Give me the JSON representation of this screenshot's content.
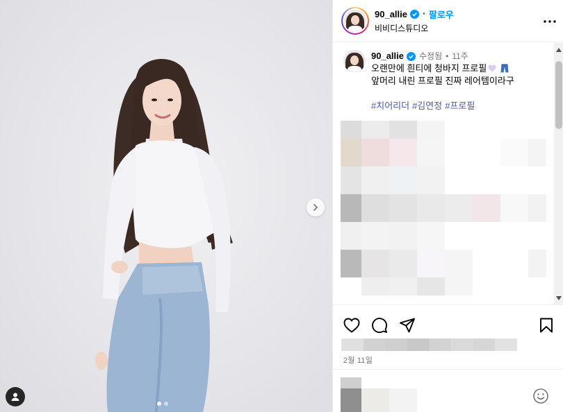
{
  "post": {
    "username": "90_allie",
    "verified": true,
    "follow_label": "팔로우",
    "separator": "•",
    "location": "비비디스튜디오"
  },
  "caption": {
    "username": "90_allie",
    "edited_label": "수정됨",
    "separator": "•",
    "time_ago": "11주",
    "line1": "오랜만에 흰티에 청바지 프로필",
    "line2": "앞머리 내린 프로필 진짜 레어템이라구",
    "hashtags": [
      "#치어리더",
      "#김연정",
      "#프로필"
    ],
    "emojis": [
      "heart-emoji",
      "jeans-emoji"
    ]
  },
  "footer": {
    "date": "2월 11일"
  },
  "icons": {
    "verified": "verified-badge-icon",
    "more": "more-options-icon",
    "next": "chevron-right-icon",
    "user_tag": "user-tag-icon",
    "like": "heart-icon",
    "comment": "comment-icon",
    "share": "share-icon",
    "save": "bookmark-icon",
    "emoji": "emoji-smile-icon"
  },
  "colors": {
    "follow": "#0095f6",
    "verified": "#0095f6",
    "hashtag": "#4a5aa8",
    "muted": "#737373"
  },
  "carousel": {
    "slides": 2,
    "active": 1
  }
}
